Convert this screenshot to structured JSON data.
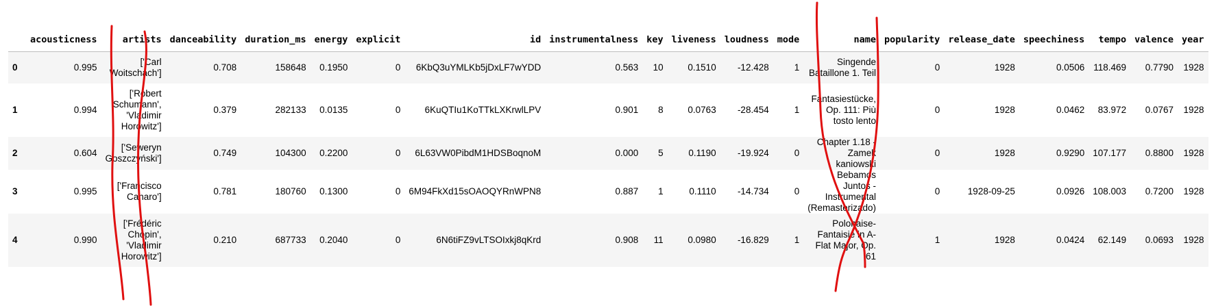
{
  "columns": [
    "acousticness",
    "artists",
    "danceability",
    "duration_ms",
    "energy",
    "explicit",
    "id",
    "instrumentalness",
    "key",
    "liveness",
    "loudness",
    "mode",
    "name",
    "popularity",
    "release_date",
    "speechiness",
    "tempo",
    "valence",
    "year"
  ],
  "rows": [
    {
      "index": "0",
      "acousticness": "0.995",
      "artists": "['Carl Woitschach']",
      "danceability": "0.708",
      "duration_ms": "158648",
      "energy": "0.1950",
      "explicit": "0",
      "id": "6KbQ3uYMLKb5jDxLF7wYDD",
      "instrumentalness": "0.563",
      "key": "10",
      "liveness": "0.1510",
      "loudness": "-12.428",
      "mode": "1",
      "name": "Singende Bataillone 1. Teil",
      "popularity": "0",
      "release_date": "1928",
      "speechiness": "0.0506",
      "tempo": "118.469",
      "valence": "0.7790",
      "year": "1928"
    },
    {
      "index": "1",
      "acousticness": "0.994",
      "artists": "['Robert Schumann', 'Vladimir Horowitz']",
      "danceability": "0.379",
      "duration_ms": "282133",
      "energy": "0.0135",
      "explicit": "0",
      "id": "6KuQTIu1KoTTkLXKrwlLPV",
      "instrumentalness": "0.901",
      "key": "8",
      "liveness": "0.0763",
      "loudness": "-28.454",
      "mode": "1",
      "name": "Fantasiestücke, Op. 111: Più tosto lento",
      "popularity": "0",
      "release_date": "1928",
      "speechiness": "0.0462",
      "tempo": "83.972",
      "valence": "0.0767",
      "year": "1928"
    },
    {
      "index": "2",
      "acousticness": "0.604",
      "artists": "['Seweryn Goszczyński']",
      "danceability": "0.749",
      "duration_ms": "104300",
      "energy": "0.2200",
      "explicit": "0",
      "id": "6L63VW0PibdM1HDSBoqnoM",
      "instrumentalness": "0.000",
      "key": "5",
      "liveness": "0.1190",
      "loudness": "-19.924",
      "mode": "0",
      "name": "Chapter 1.18 - Zamek kaniowski",
      "popularity": "0",
      "release_date": "1928",
      "speechiness": "0.9290",
      "tempo": "107.177",
      "valence": "0.8800",
      "year": "1928"
    },
    {
      "index": "3",
      "acousticness": "0.995",
      "artists": "['Francisco Canaro']",
      "danceability": "0.781",
      "duration_ms": "180760",
      "energy": "0.1300",
      "explicit": "0",
      "id": "6M94FkXd15sOAOQYRnWPN8",
      "instrumentalness": "0.887",
      "key": "1",
      "liveness": "0.1110",
      "loudness": "-14.734",
      "mode": "0",
      "name": "Bebamos Juntos - Instrumental (Remasterizado)",
      "popularity": "0",
      "release_date": "1928-09-25",
      "speechiness": "0.0926",
      "tempo": "108.003",
      "valence": "0.7200",
      "year": "1928"
    },
    {
      "index": "4",
      "acousticness": "0.990",
      "artists": "['Frédéric Chopin', 'Vladimir Horowitz']",
      "danceability": "0.210",
      "duration_ms": "687733",
      "energy": "0.2040",
      "explicit": "0",
      "id": "6N6tiFZ9vLTSOIxkj8qKrd",
      "instrumentalness": "0.908",
      "key": "11",
      "liveness": "0.0980",
      "loudness": "-16.829",
      "mode": "1",
      "name": "Polonaise-Fantaisie in A-Flat Major, Op. 61",
      "popularity": "1",
      "release_date": "1928",
      "speechiness": "0.0424",
      "tempo": "62.149",
      "valence": "0.0693",
      "year": "1928"
    }
  ],
  "annotation": {
    "stroke_color": "#e01010"
  }
}
